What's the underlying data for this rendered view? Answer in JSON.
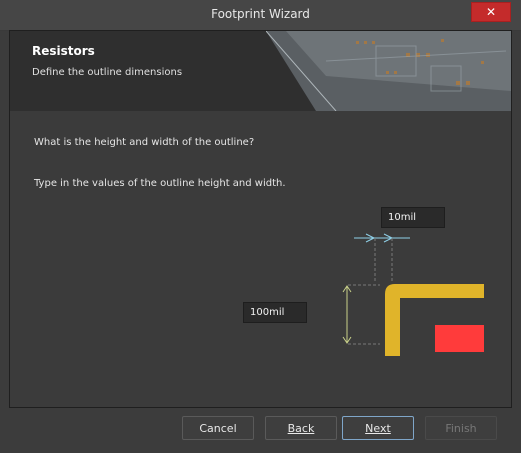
{
  "window": {
    "title": "Footprint Wizard",
    "close_label": "✕"
  },
  "banner": {
    "heading": "Resistors",
    "subheading": "Define the outline dimensions"
  },
  "content": {
    "question": "What is the height and width of the outline?",
    "instruction": "Type in the values of the outline height and width."
  },
  "inputs": {
    "width_value": "10mil",
    "height_value": "100mil"
  },
  "buttons": {
    "cancel": "Cancel",
    "back": "Back",
    "next": "Next",
    "finish": "Finish"
  },
  "colors": {
    "outline": "#e0b42a",
    "pad": "#ff3b3b",
    "dimension_line": "#8fd0e8"
  }
}
